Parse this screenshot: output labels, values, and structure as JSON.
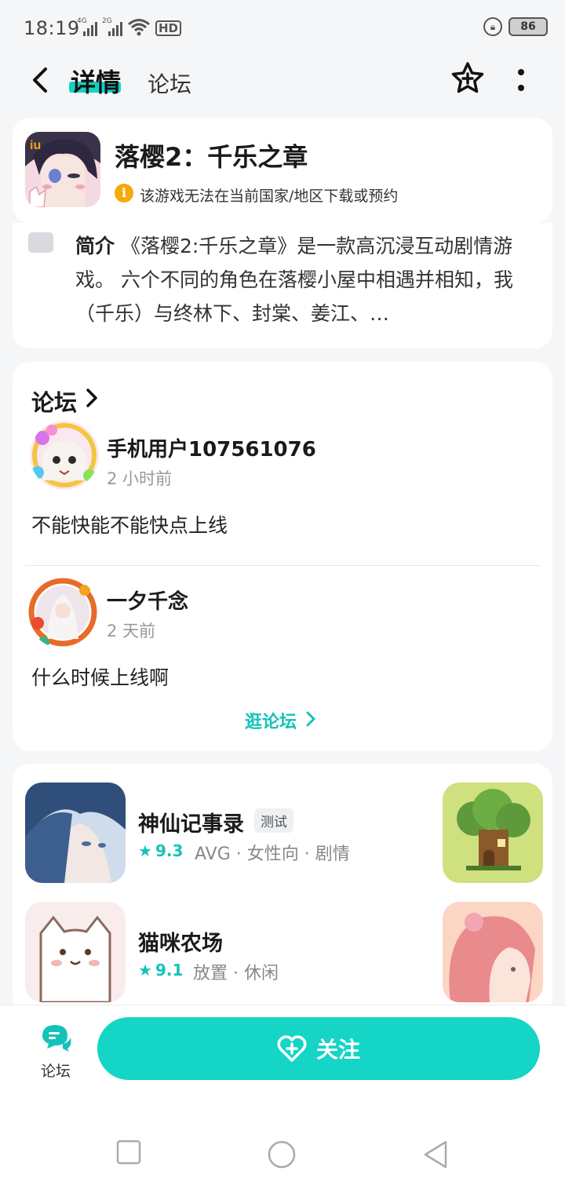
{
  "status_bar": {
    "time": "18:19",
    "net1": "4G",
    "net2": "2G",
    "hd": "HD",
    "battery": "86"
  },
  "header": {
    "tab_detail": "详情",
    "tab_forum": "论坛",
    "icons": [
      "back-icon",
      "star-add-icon",
      "more-icon"
    ]
  },
  "game": {
    "title": "落樱2：千乐之章",
    "warning": "该游戏无法在当前国家/地区下载或预约"
  },
  "intro": {
    "label": "简介",
    "text": "《落樱2:千乐之章》是一款高沉浸互动剧情游戏。 六个不同的角色在落樱小屋中相遇并相知，我（千乐）与终林下、封棠、姜江、…"
  },
  "forum": {
    "title": "论坛",
    "posts": [
      {
        "user": "手机用户107561076",
        "time": "2 小时前",
        "content": "不能快能不能快点上线"
      },
      {
        "user": "一夕千念",
        "time": "2 天前",
        "content": "什么时候上线啊"
      }
    ],
    "more": "逛论坛"
  },
  "recommend": [
    {
      "name": "神仙记事录",
      "tag": "测试",
      "score": "9.3",
      "genre": "AVG · 女性向 · 剧情"
    },
    {
      "name": "猫咪农场",
      "tag": "",
      "score": "9.1",
      "genre": "放置 · 休闲"
    }
  ],
  "bottom": {
    "forum_label": "论坛",
    "follow_label": "关注"
  },
  "colors": {
    "accent": "#14d5c6",
    "warning": "#f5a90a"
  }
}
